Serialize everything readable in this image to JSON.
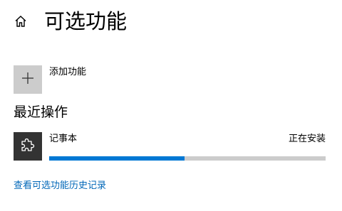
{
  "header": {
    "home_icon": "home-icon",
    "title": "可选功能"
  },
  "add_feature": {
    "icon": "plus-icon",
    "label": "添加功能"
  },
  "recent": {
    "section_title": "最近操作",
    "items": [
      {
        "icon": "puzzle-piece-icon",
        "name": "记事本",
        "status": "正在安装",
        "progress": 0.49
      }
    ]
  },
  "history_link": "查看可选功能历史记录",
  "colors": {
    "accent": "#0078d4",
    "link": "#0067b8",
    "tile_gray": "#cccccc",
    "tile_dark": "#333333",
    "track": "#cccccc"
  }
}
